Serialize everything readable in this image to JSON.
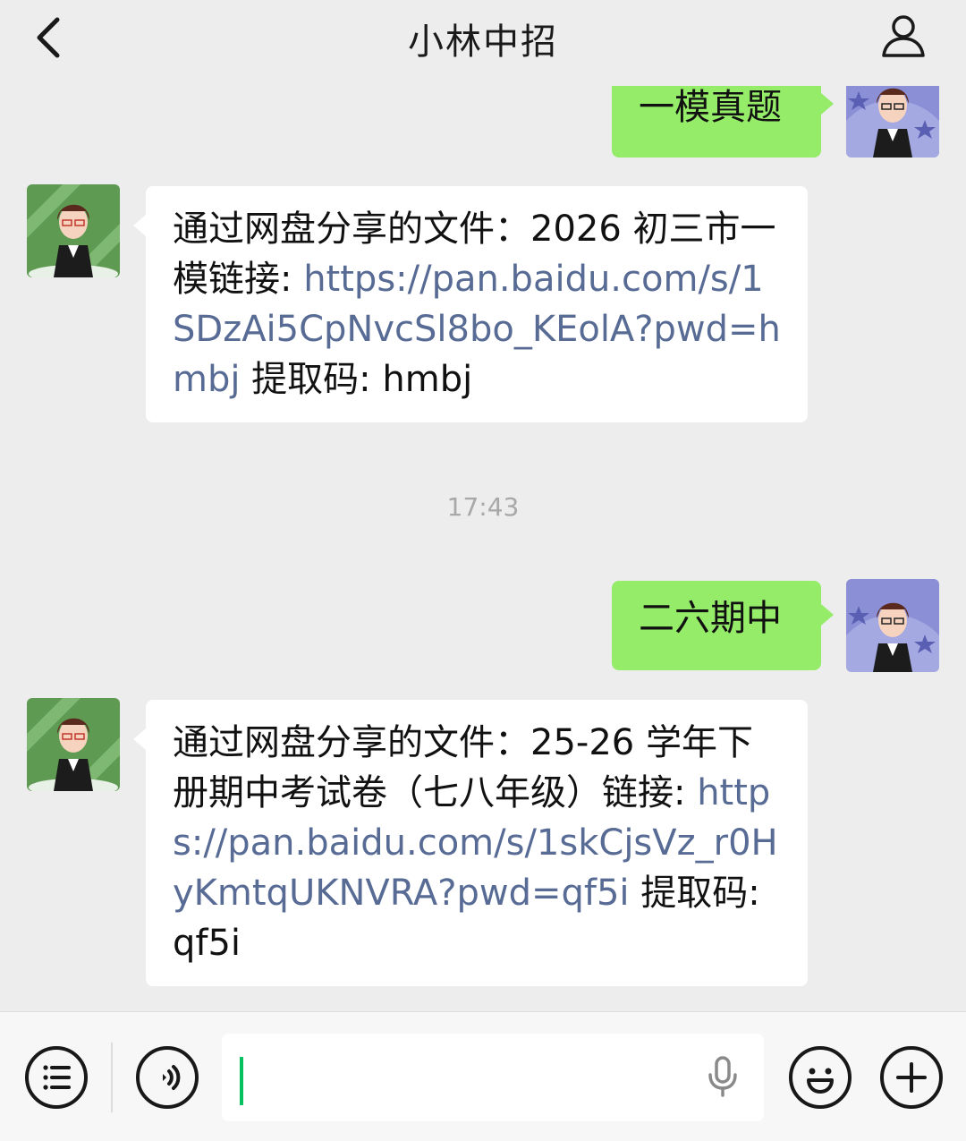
{
  "header": {
    "title": "小林中招",
    "back_icon": "chevron-left-icon",
    "profile_icon": "person-icon"
  },
  "messages": [
    {
      "side": "right",
      "type": "text",
      "text": "一模真题"
    },
    {
      "side": "left",
      "type": "text",
      "prefix": "通过网盘分享的文件：2026 初三市一模链接: ",
      "link": "https://pan.baidu.com/s/1SDzAi5CpNvcSl8bo_KEolA?pwd=hmbj",
      "suffix": " 提取码: hmbj"
    },
    {
      "type": "timestamp",
      "text": "17:43"
    },
    {
      "side": "right",
      "type": "text",
      "text": "二六期中"
    },
    {
      "side": "left",
      "type": "text",
      "prefix": "通过网盘分享的文件：25-26 学年下册期中考试卷（七八年级）链接: ",
      "link": "https://pan.baidu.com/s/1skCjsVz_r0HyKmtqUKNVRA?pwd=qf5i",
      "suffix": " 提取码: qf5i"
    }
  ],
  "input_bar": {
    "menu_icon": "list-menu-icon",
    "voice_icon": "voice-toggle-icon",
    "mic_icon": "microphone-icon",
    "emoji_icon": "emoji-icon",
    "plus_icon": "plus-icon",
    "input_value": ""
  },
  "colors": {
    "background": "#ededed",
    "sent_bubble": "#95ec69",
    "received_bubble": "#ffffff",
    "link": "#576b95",
    "caret": "#07c160"
  }
}
